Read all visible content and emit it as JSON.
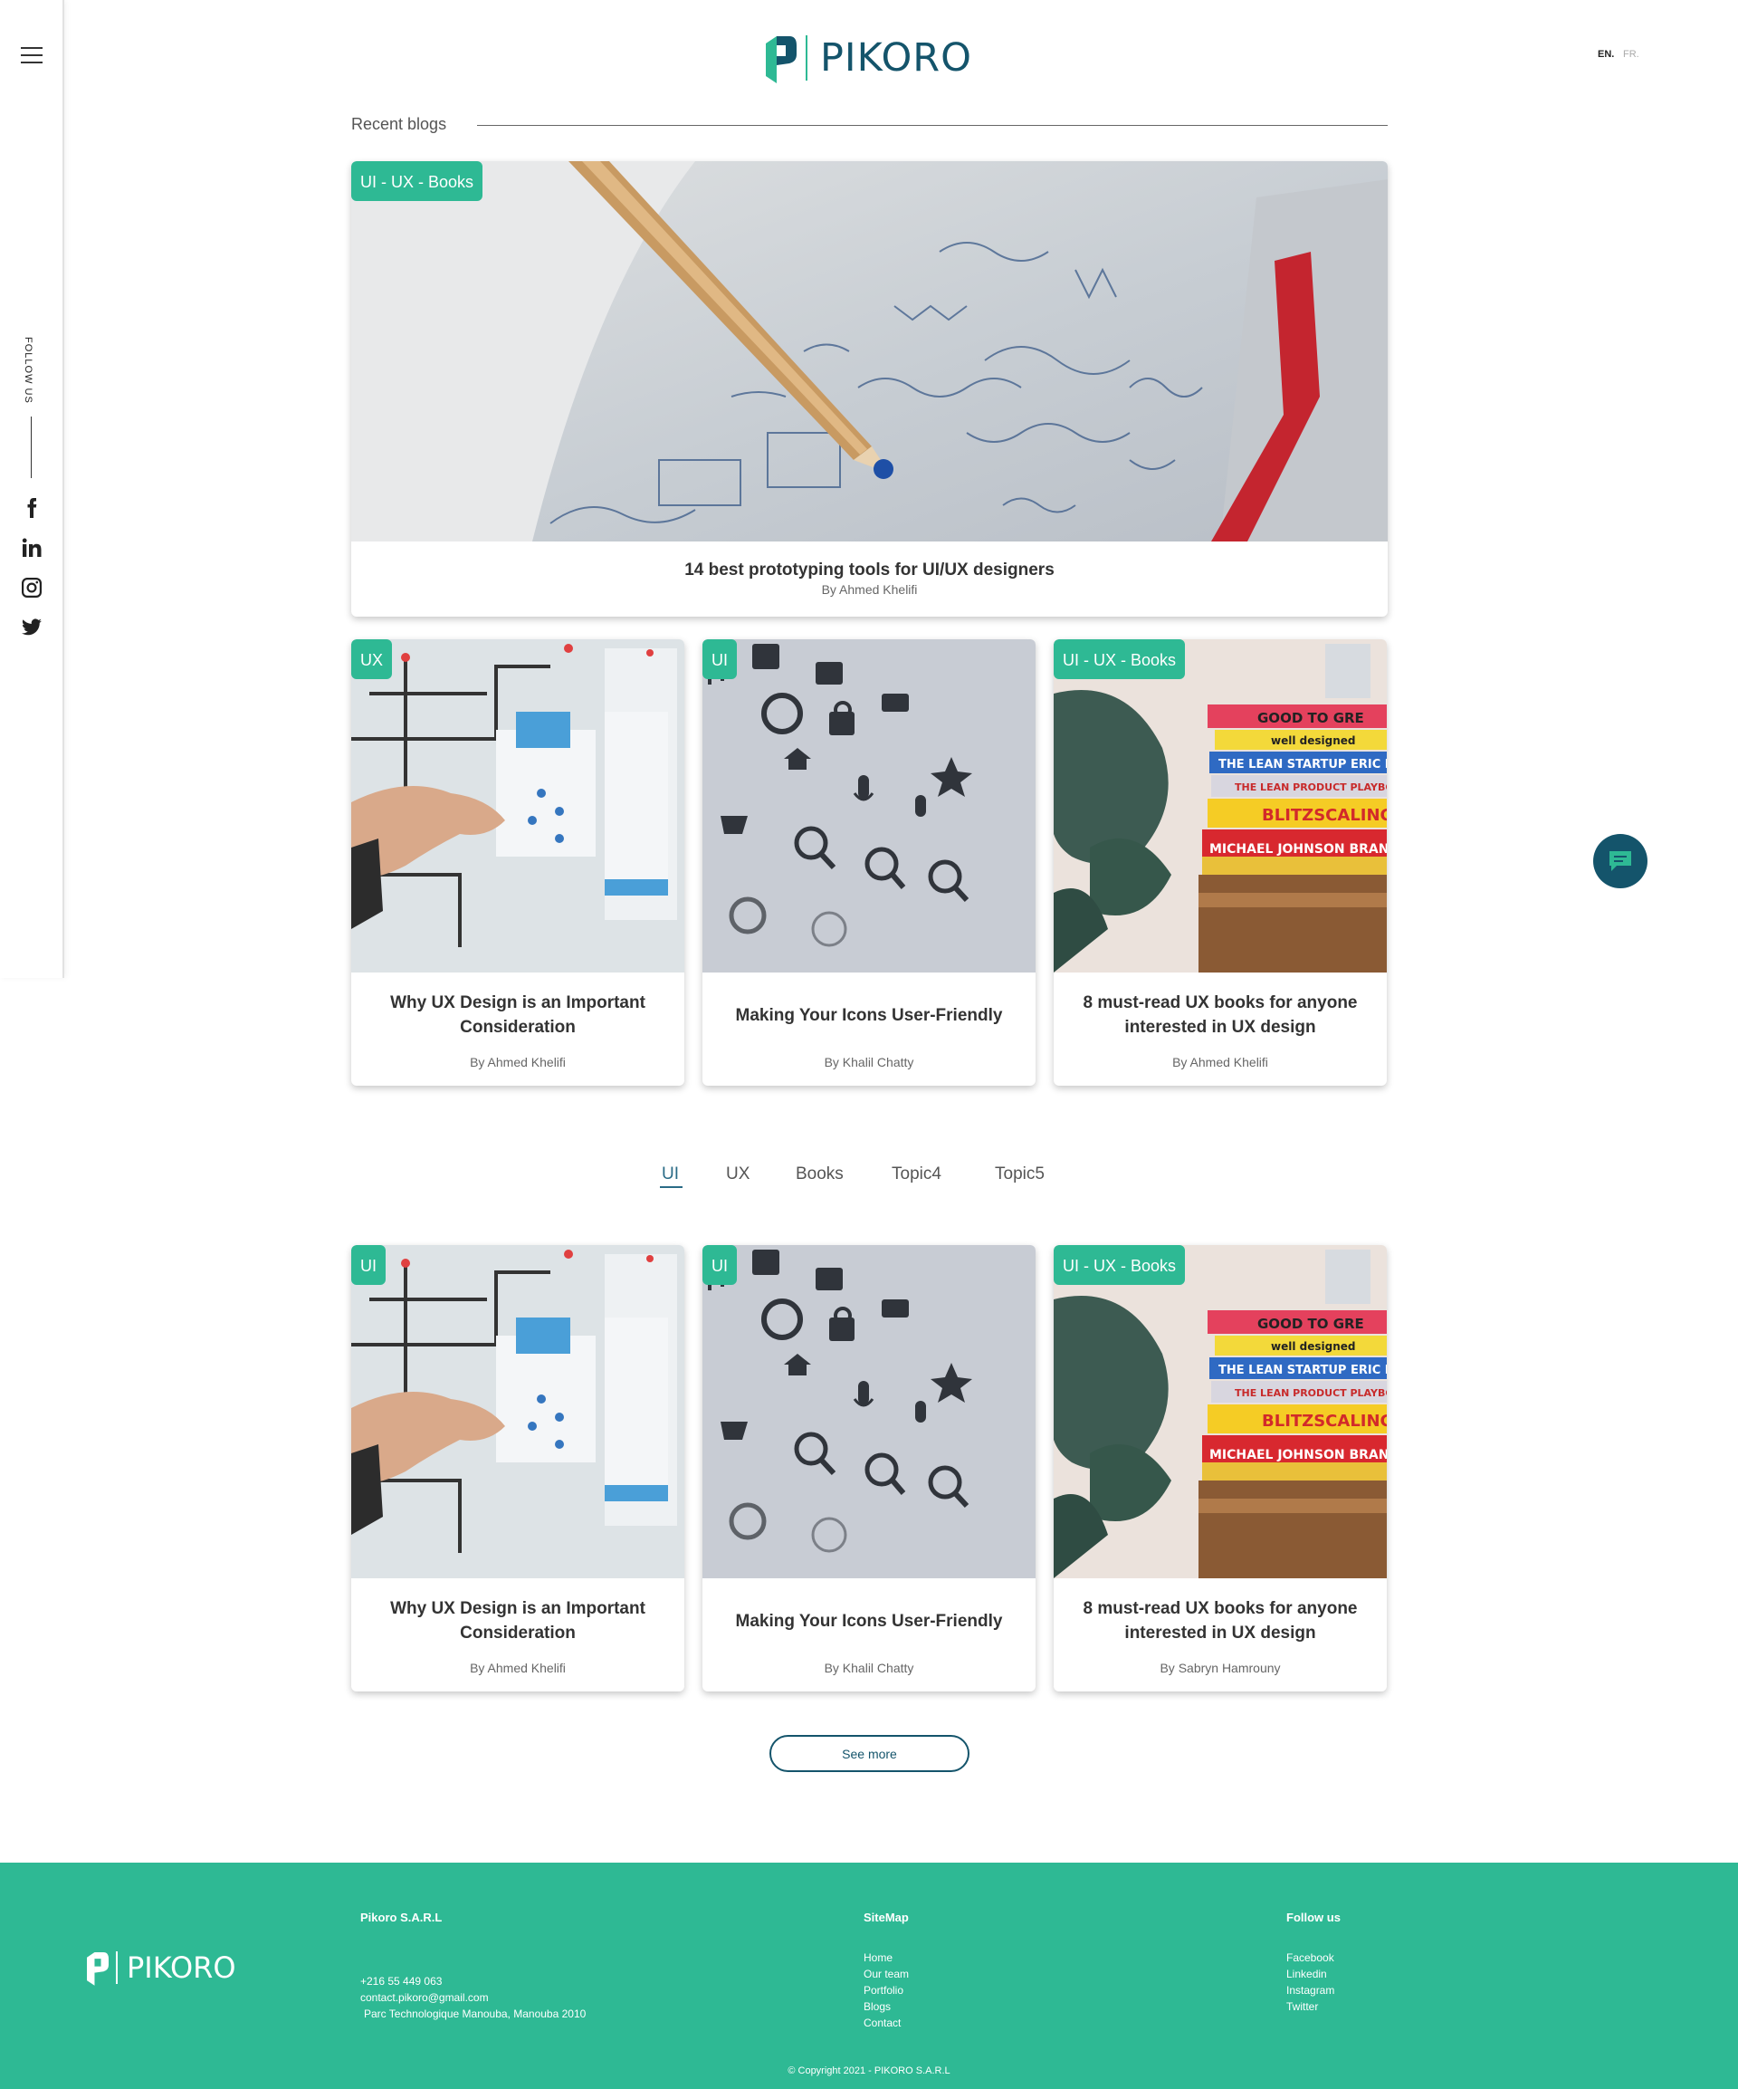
{
  "brand": {
    "name": "PIKORO",
    "colors": {
      "accent": "#2eb994",
      "primary": "#14546b"
    }
  },
  "sidebar": {
    "follow_label": "FOLLOW US",
    "socials": [
      "facebook-icon",
      "linkedin-icon",
      "instagram-icon",
      "twitter-icon"
    ]
  },
  "lang": {
    "en": "EN.",
    "fr": "FR."
  },
  "recent": {
    "title": "Recent blogs",
    "featured": {
      "tag": "UI - UX - Books",
      "title": "14 best prototyping tools for UI/UX designers",
      "author": "By Ahmed Khelifi"
    },
    "cards": [
      {
        "tag": "UX",
        "title": "Why UX Design is an Important Consideration",
        "author": "By Ahmed Khelifi"
      },
      {
        "tag": "UI",
        "title": "Making Your Icons User-Friendly",
        "author": "By Khalil Chatty"
      },
      {
        "tag": "UI - UX - Books",
        "title": "8 must-read UX books for anyone interested in UX design",
        "author": "By Ahmed Khelifi"
      }
    ]
  },
  "tabs": [
    "UI",
    "UX",
    "Books",
    "Topic4",
    "Topic5"
  ],
  "topic_cards": [
    {
      "tag": "UI",
      "title": "Why UX Design is an Important Consideration",
      "author": "By Ahmed Khelifi"
    },
    {
      "tag": "UI",
      "title": "Making Your Icons User-Friendly",
      "author": "By Khalil Chatty"
    },
    {
      "tag": "UI - UX - Books",
      "title": "8 must-read UX books for anyone interested in UX design",
      "author": "By Sabryn Hamrouny"
    }
  ],
  "see_more": "See more",
  "footer": {
    "company": "Pikoro S.A.R.L",
    "phone": "+216 55 449 063",
    "email": "contact.pikoro@gmail.com",
    "address": "Parc Technologique Manouba, Manouba 2010",
    "sitemap_title": "SiteMap",
    "sitemap": [
      "Home",
      "Our team",
      "Portfolio",
      "Blogs",
      "Contact"
    ],
    "follow_title": "Follow us",
    "follow": [
      "Facebook",
      "Linkedin",
      "Instagram",
      "Twitter"
    ],
    "copyright": "© Copyright 2021 - PIKORO S.A.R.L"
  }
}
